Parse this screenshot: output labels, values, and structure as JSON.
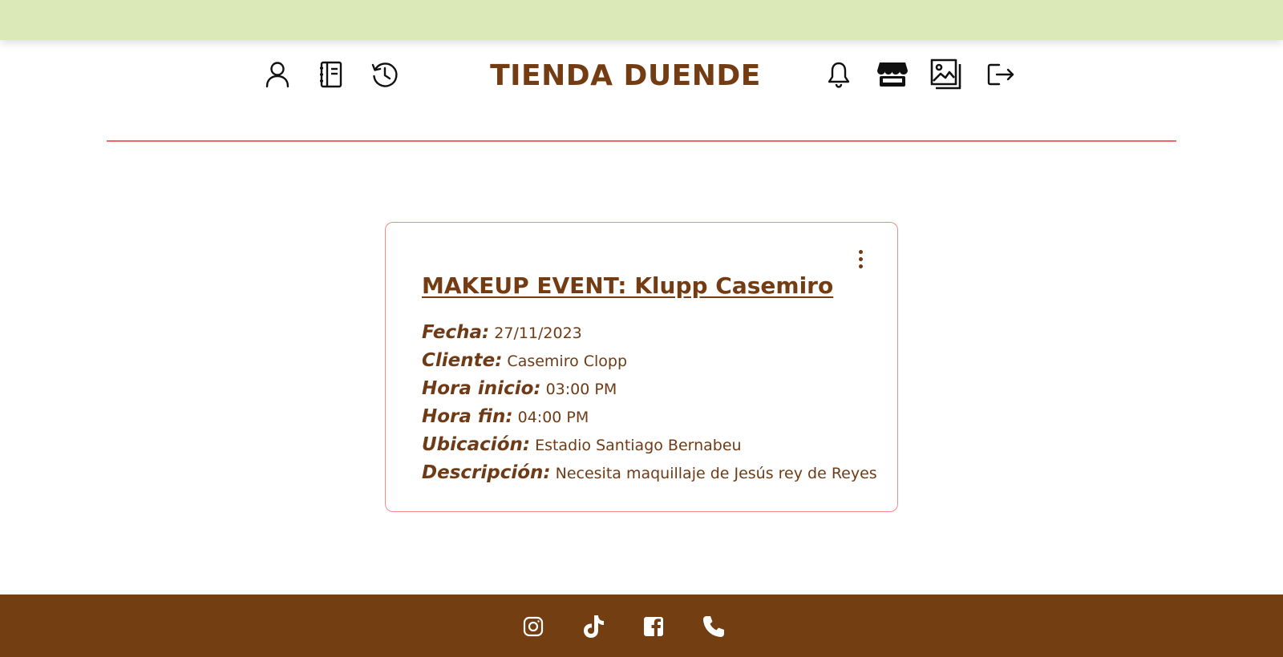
{
  "brand": {
    "name": "TIENDA DUENDE"
  },
  "header": {
    "left_icons": [
      "user-icon",
      "notebook-icon",
      "history-icon"
    ],
    "right_icons": [
      "bell-icon",
      "store-icon",
      "gallery-icon",
      "logout-icon"
    ]
  },
  "event": {
    "title": "MAKEUP EVENT: Klupp Casemiro",
    "details": [
      {
        "label": "Fecha:",
        "value": "27/11/2023"
      },
      {
        "label": "Cliente:",
        "value": "Casemiro Clopp"
      },
      {
        "label": "Hora inicio:",
        "value": "03:00 PM"
      },
      {
        "label": "Hora fin:",
        "value": "04:00 PM"
      },
      {
        "label": "Ubicación:",
        "value": "Estadio Santiago Bernabeu"
      },
      {
        "label": "Descripción:",
        "value": "Necesita maquillaje de Jesús rey de Reyes"
      }
    ],
    "menu_icon": "more-vertical-icon"
  },
  "footer": {
    "social_icons": [
      "instagram-icon",
      "tiktok-icon",
      "facebook-icon",
      "phone-icon"
    ]
  },
  "colors": {
    "top_bar": "#dbe9b8",
    "brand_brown": "#733c12",
    "divider_red": "#ec6a6a",
    "card_border": "#f08b8b",
    "footer_brown": "#733e12"
  }
}
